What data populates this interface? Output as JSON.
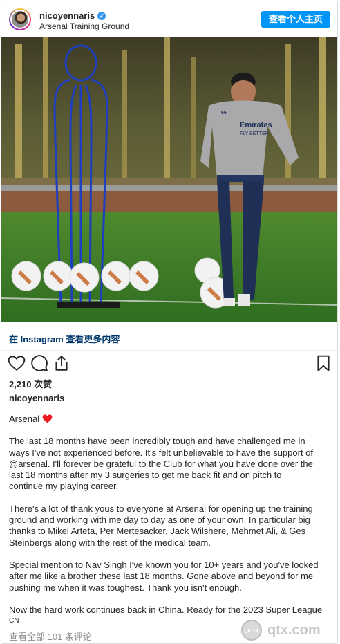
{
  "header": {
    "username": "nicoyennaris",
    "location": "Arsenal Training Ground",
    "profile_button": "查看个人主页"
  },
  "photo": {
    "shirt_text_1": "Emirates",
    "shirt_text_2": "FLY BETTER",
    "shirt_number": "66"
  },
  "view_more": "在 Instagram 查看更多内容",
  "actions": {
    "like_icon": "heart-outline-icon",
    "comment_icon": "comment-icon",
    "share_icon": "share-icon",
    "save_icon": "bookmark-icon"
  },
  "likes": "2,210 次赞",
  "caption_username": "nicoyennaris",
  "caption": {
    "p1": "Arsenal",
    "p2": "The last 18 months have been incredibly tough and have challenged me in\nways I've not experienced before. It's felt unbelievable to have the support of\n@arsenal. I'll forever be grateful to the Club for what you have done over the\nlast 18 months after my 3 surgeries to get me back fit and on pitch to\ncontinue my playing career.",
    "p3": "There's a lot of thank yous to everyone at Arsenal for opening up the training\nground and working with me day to day as one of your own. In particular big\nthanks to Mikel Arteta, Per Mertesacker, Jack Wilshere, Mehmet Ali, & Ges\nSteinbergs along with the rest of the medical team.",
    "p4": "Special mention to Nav Singh I've known you for 10+ years and you've looked\nafter me like a brother these last 18 months. Gone above and beyond for me\npushing me when it was toughest. Thank you isn't enough.",
    "p5": "Now the hard work continues back in China. Ready for the 2023 Super League"
  },
  "tag": "CN",
  "comments_link": "查看全部 101 条评论",
  "watermark": {
    "text": "qtx.com",
    "logo_text": "QIUTX"
  },
  "colors": {
    "accent": "#0095f6",
    "link": "#00376b",
    "heart": "#ed1c24"
  }
}
